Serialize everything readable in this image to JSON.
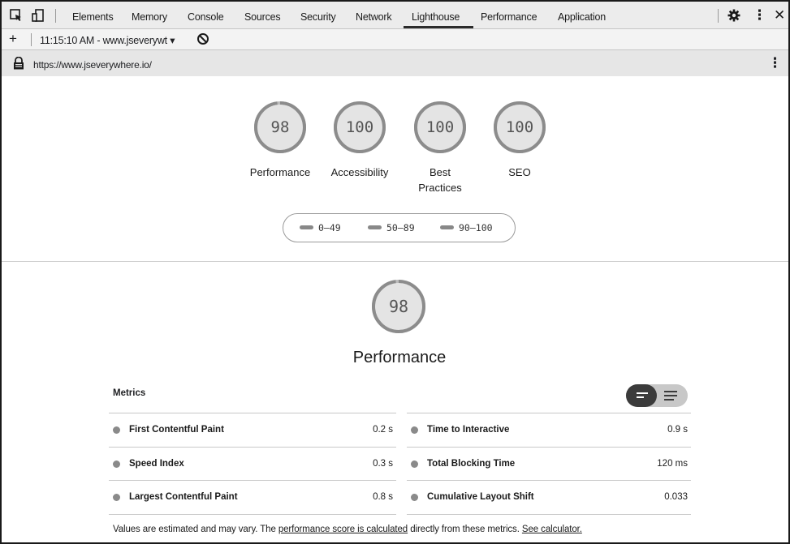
{
  "devtools": {
    "tabs": [
      {
        "label": "Elements"
      },
      {
        "label": "Memory"
      },
      {
        "label": "Console"
      },
      {
        "label": "Sources"
      },
      {
        "label": "Security"
      },
      {
        "label": "Network"
      },
      {
        "label": "Lighthouse"
      },
      {
        "label": "Performance"
      },
      {
        "label": "Application"
      }
    ],
    "active_tab": "Lighthouse",
    "icons": [
      "inspect-element-icon",
      "device-toolbar-icon",
      "gear-icon",
      "more-vertical-icon",
      "close-icon"
    ]
  },
  "report_bar": {
    "add_label": "+",
    "report_selector": "11:15:10 AM - www.jseverywt ▾"
  },
  "url_bar": {
    "url": "https://www.jseverywhere.io/"
  },
  "scores": [
    {
      "value": "98",
      "fraction": 0.98,
      "label": "Performance"
    },
    {
      "value": "100",
      "fraction": 1.0,
      "label": "Accessibility"
    },
    {
      "value": "100",
      "fraction": 1.0,
      "label": "Best Practices"
    },
    {
      "value": "100",
      "fraction": 1.0,
      "label": "SEO"
    }
  ],
  "legend": [
    "0–49",
    "50–89",
    "90–100"
  ],
  "performance": {
    "score": "98",
    "fraction": 0.98,
    "title": "Performance"
  },
  "metrics": {
    "title": "Metrics",
    "left": [
      {
        "name": "First Contentful Paint",
        "value": "0.2 s"
      },
      {
        "name": "Speed Index",
        "value": "0.3 s"
      },
      {
        "name": "Largest Contentful Paint",
        "value": "0.8 s"
      }
    ],
    "right": [
      {
        "name": "Time to Interactive",
        "value": "0.9 s"
      },
      {
        "name": "Total Blocking Time",
        "value": "120 ms"
      },
      {
        "name": "Cumulative Layout Shift",
        "value": "0.033"
      }
    ]
  },
  "footnote": {
    "prefix": "Values are estimated and may vary. The ",
    "link1": "performance score is calculated",
    "middle": " directly from these metrics. ",
    "link2": "See calculator."
  }
}
